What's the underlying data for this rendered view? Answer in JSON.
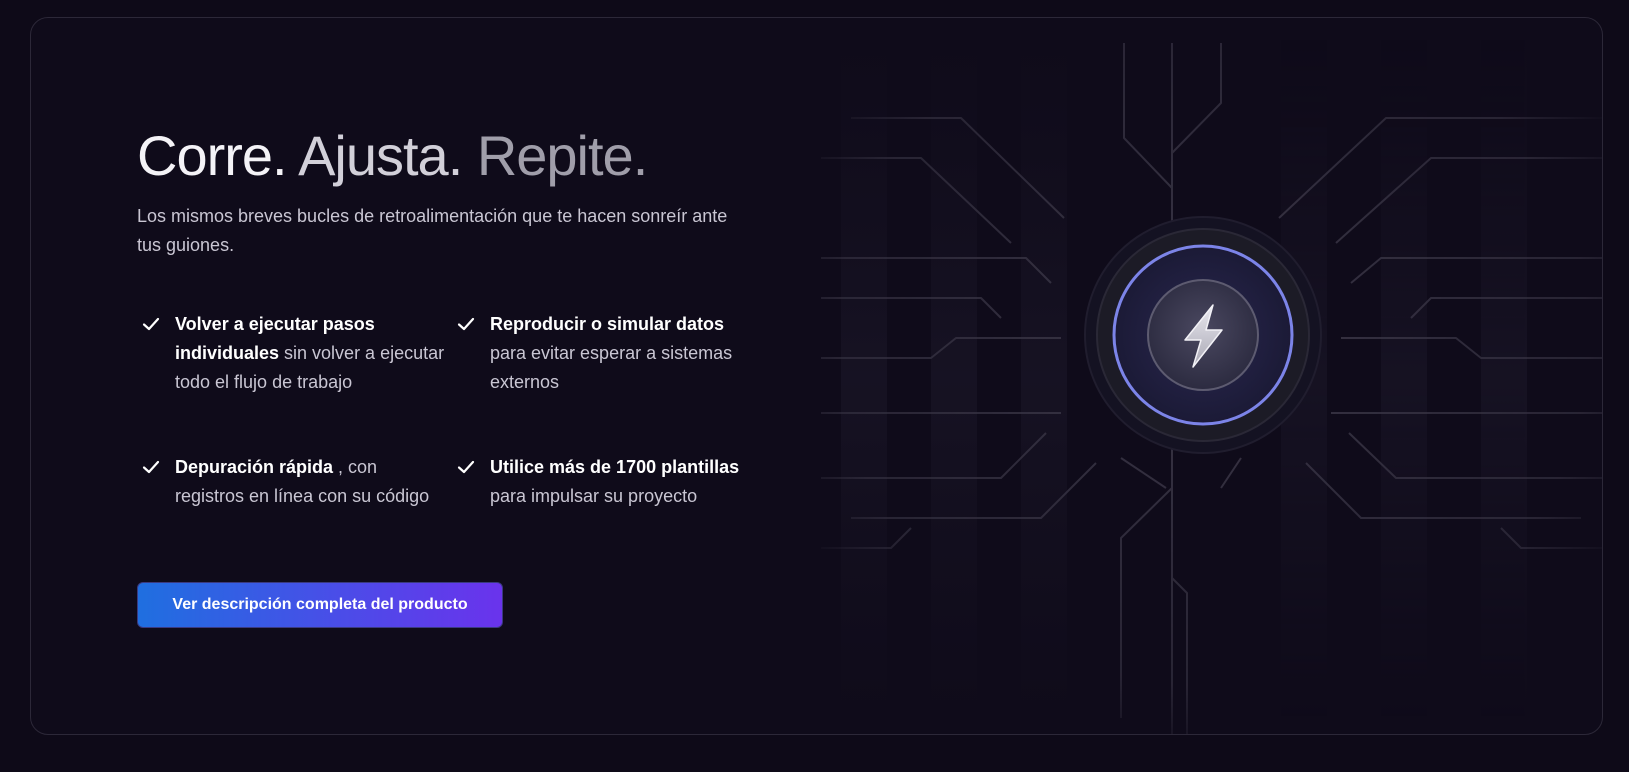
{
  "hero": {
    "headline_part1": "Corre.",
    "headline_part2": "Ajusta.",
    "headline_part3": "Repite.",
    "subtitle": "Los mismos breves bucles de retroalimentación que te hacen sonreír ante tus guiones."
  },
  "features": [
    {
      "bold": "Volver a ejecutar pasos individuales",
      "rest": " sin volver a ejecutar todo el flujo de trabajo"
    },
    {
      "bold": "Reproducir o simular datos",
      "rest": " para evitar esperar a sistemas externos"
    },
    {
      "bold": "Depuración rápida",
      "rest": " , con registros en línea con su código"
    },
    {
      "bold": "Utilice más de 1700 plantillas",
      "rest": " para impulsar su proyecto"
    }
  ],
  "cta": {
    "label": "Ver descripción completa del producto"
  },
  "graphic": {
    "icon": "lightning-bolt-icon",
    "ring_color": "#7c84e8"
  },
  "colors": {
    "background": "#0e0a18",
    "card_border": "#2c2838",
    "accent_start": "#1f6fe0",
    "accent_end": "#6a33ec"
  }
}
